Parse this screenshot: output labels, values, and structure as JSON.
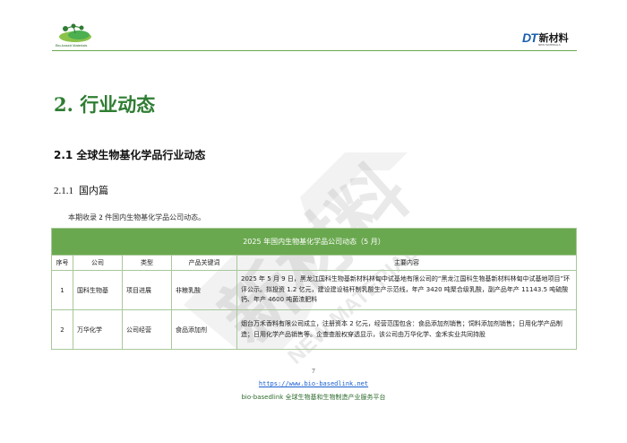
{
  "header": {
    "left_logo_text": "Bio-based Materials",
    "right_logo_mark": "DT",
    "right_logo_name": "新材料",
    "right_logo_sub": "NEW MATERIALS",
    "accent": "#6aa84f",
    "brand_blue": "#1b5fae"
  },
  "watermark": {
    "main": "新材料",
    "sub": "NEW MATERIALS"
  },
  "headings": {
    "h1": "2.  行业动态",
    "h2": "2.1  全球生物基化学品行业动态",
    "h3_num": "2.1.1",
    "h3_text": "国内篇"
  },
  "intro": {
    "before": "本期收录 ",
    "count": "2",
    "after": " 件国内生物基化学品公司动态。"
  },
  "table": {
    "title": "2025 年国内生物基化学品公司动态（5 月）",
    "columns": [
      "序号",
      "公司",
      "类型",
      "产品关键词",
      "主要内容"
    ],
    "rows": [
      {
        "no": "1",
        "company": "国科生物基",
        "type": "项目进展",
        "keyword": "非粮乳酸",
        "content": "2025 年 5 月 9 日，黑龙江国科生物基新材料林甸中试基地有限公司的“黑龙江国科生物基新材料林甸中试基地项目”环评公示。拟投资 1.2 亿元，建设建设秸秆制乳酸生产示范线，年产 3420 吨聚合级乳酸，副产品年产 11143.5 吨硫酸钙、年产 4600 吨菌渣肥料"
      },
      {
        "no": "2",
        "company": "万华化学",
        "type": "公司经营",
        "keyword": "食品添加剂",
        "content": "烟台万禾香料有限公司成立，注册资本 2 亿元，经营范围包含：食品添加剂销售；饲料添加剂销售；日用化学产品制造；日用化学产品销售等。企查查股权穿透显示，该公司由万华化学、金禾实业共同持股"
      }
    ]
  },
  "footer": {
    "page_number": "7",
    "url": "https://www.bio-basedlink.net",
    "text": "bio-basedlink 全球生物基和生物制造产业服务平台"
  }
}
